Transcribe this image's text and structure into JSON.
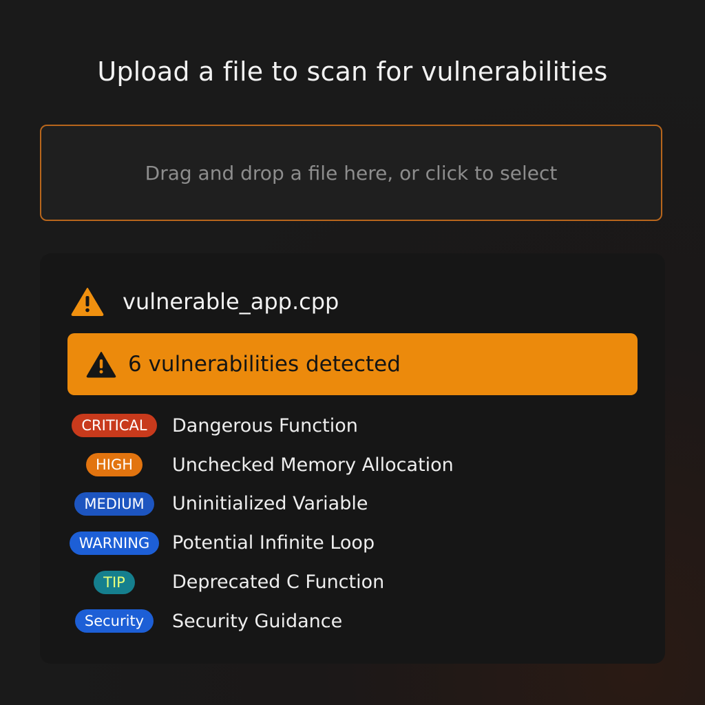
{
  "page": {
    "title": "Upload a file to scan for vulnerabilities"
  },
  "dropzone": {
    "text": "Drag and drop a file here, or click to select"
  },
  "result": {
    "file_name": "vulnerable_app.cpp",
    "file_icon": "warning-triangle-icon",
    "alert_text": "6 vulnerabilities detected",
    "alert_color": "#ec8a0c",
    "vulnerabilities": [
      {
        "severity": "CRITICAL",
        "title": "Dangerous Function",
        "color": "#c83a1c"
      },
      {
        "severity": "HIGH",
        "title": "Unchecked Memory Allocation",
        "color": "#e2740f"
      },
      {
        "severity": "MEDIUM",
        "title": "Uninitialized Variable",
        "color": "#1d55c0"
      },
      {
        "severity": "WARNING",
        "title": "Potential Infinite Loop",
        "color": "#1d5fd6"
      },
      {
        "severity": "TIP",
        "title": "Deprecated C Function",
        "color": "#157f8e"
      },
      {
        "severity": "Security",
        "title": "Security Guidance",
        "color": "#1d5fd6"
      }
    ]
  }
}
